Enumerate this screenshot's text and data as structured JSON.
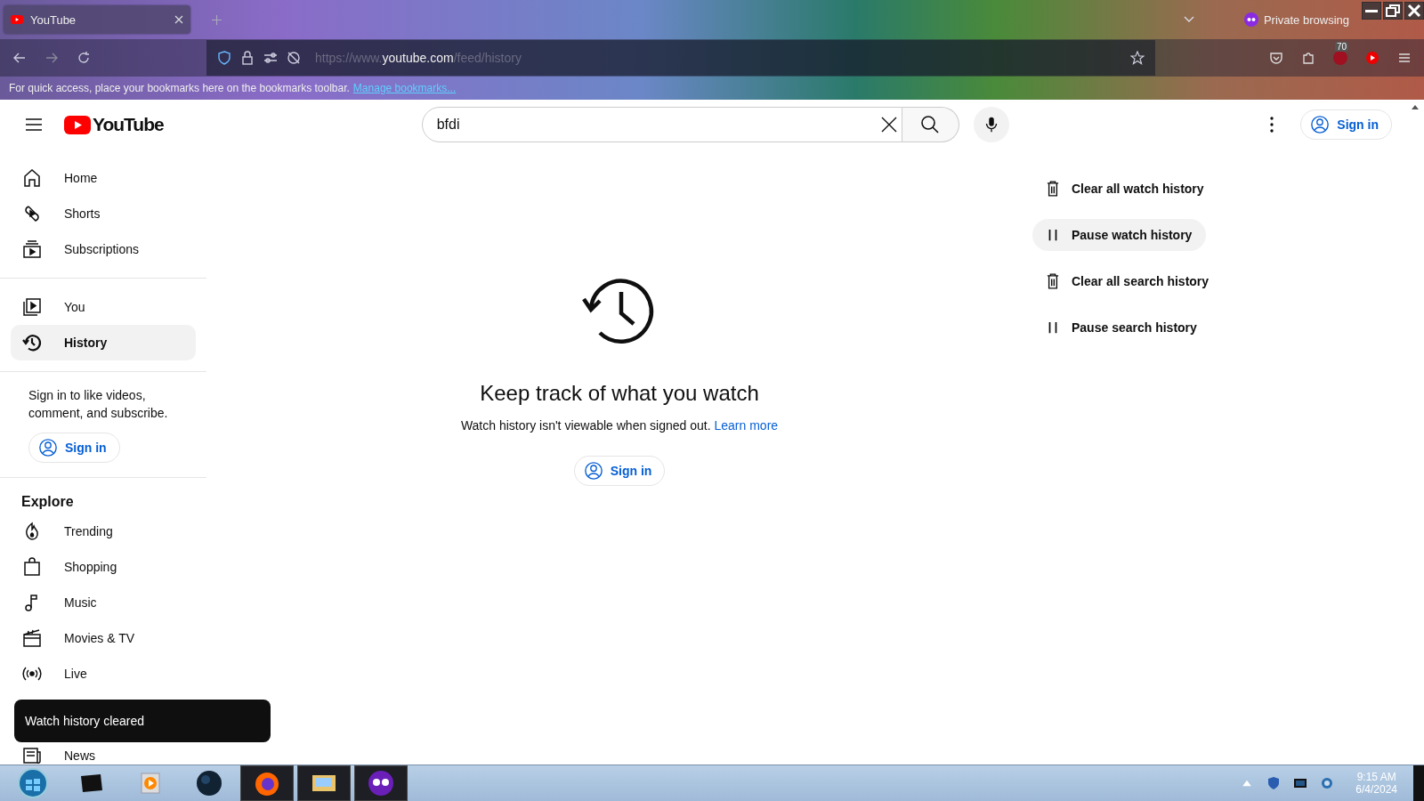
{
  "browser": {
    "tabs": [
      {
        "title": "YouTube",
        "selected": true
      }
    ],
    "private_label": "Private browsing",
    "url": {
      "prefix": "https://www.",
      "host": "youtube.com",
      "path": "/feed/history"
    },
    "extension_badge": "70",
    "bookmarks_hint": "For quick access, place your bookmarks here on the bookmarks toolbar.",
    "bookmarks_link": "Manage bookmarks..."
  },
  "header": {
    "logo": "YouTube",
    "search": {
      "value": "bfdi"
    },
    "sign_in": "Sign in"
  },
  "sidebar": {
    "sections": [
      {
        "items": [
          {
            "label": "Home",
            "kind": "home",
            "selected": false
          },
          {
            "label": "Shorts",
            "kind": "shorts",
            "selected": false
          },
          {
            "label": "Subscriptions",
            "kind": "subscriptions",
            "selected": false
          }
        ]
      },
      {
        "items": [
          {
            "label": "You",
            "kind": "you",
            "selected": false
          },
          {
            "label": "History",
            "kind": "history",
            "selected": true
          }
        ]
      }
    ],
    "signin_prompt": "Sign in to like videos, comment, and subscribe.",
    "sign_in": "Sign in",
    "explore_title": "Explore",
    "explore": [
      {
        "label": "Trending",
        "kind": "trending",
        "selected": false
      },
      {
        "label": "Shopping",
        "kind": "shopping",
        "selected": false
      },
      {
        "label": "Music",
        "kind": "music",
        "selected": false
      },
      {
        "label": "Movies & TV",
        "kind": "movies",
        "selected": false
      },
      {
        "label": "Live",
        "kind": "live",
        "selected": false
      },
      {
        "label": "News",
        "kind": "news",
        "selected": false
      }
    ]
  },
  "empty_state": {
    "title": "Keep track of what you watch",
    "message": "Watch history isn't viewable when signed out.",
    "link": "Learn more",
    "sign_in": "Sign in"
  },
  "actions": [
    {
      "label": "Clear all watch history",
      "kind": "trash",
      "highlighted": false
    },
    {
      "label": "Pause watch history",
      "kind": "pause",
      "highlighted": true
    },
    {
      "label": "Clear all search history",
      "kind": "trash",
      "highlighted": false
    },
    {
      "label": "Pause search history",
      "kind": "pause",
      "highlighted": false
    }
  ],
  "toast": "Watch history cleared",
  "taskbar": {
    "time": "9:15 AM",
    "date": "6/4/2024"
  }
}
